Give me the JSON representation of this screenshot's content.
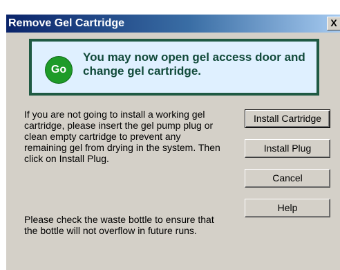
{
  "window": {
    "title": "Remove Gel Cartridge",
    "close_label": "X"
  },
  "status_panel": {
    "badge_label": "Go",
    "message": "You may now open gel access door and change gel cartridge.",
    "colors": {
      "border": "#1f5a43",
      "background": "#dff0ff",
      "badge": "#1e9b28",
      "text": "#114a3a"
    }
  },
  "instructions": {
    "paragraph1": "If you are not going to install a working gel cartridge, please insert the gel pump plug or clean empty cartridge to prevent any remaining gel from drying in the system. Then click on Install Plug.",
    "paragraph2": "Please check the waste bottle to ensure that the bottle will not overflow in future runs."
  },
  "buttons": {
    "install_cartridge": "Install Cartridge",
    "install_plug": "Install Plug",
    "cancel": "Cancel",
    "help": "Help"
  }
}
